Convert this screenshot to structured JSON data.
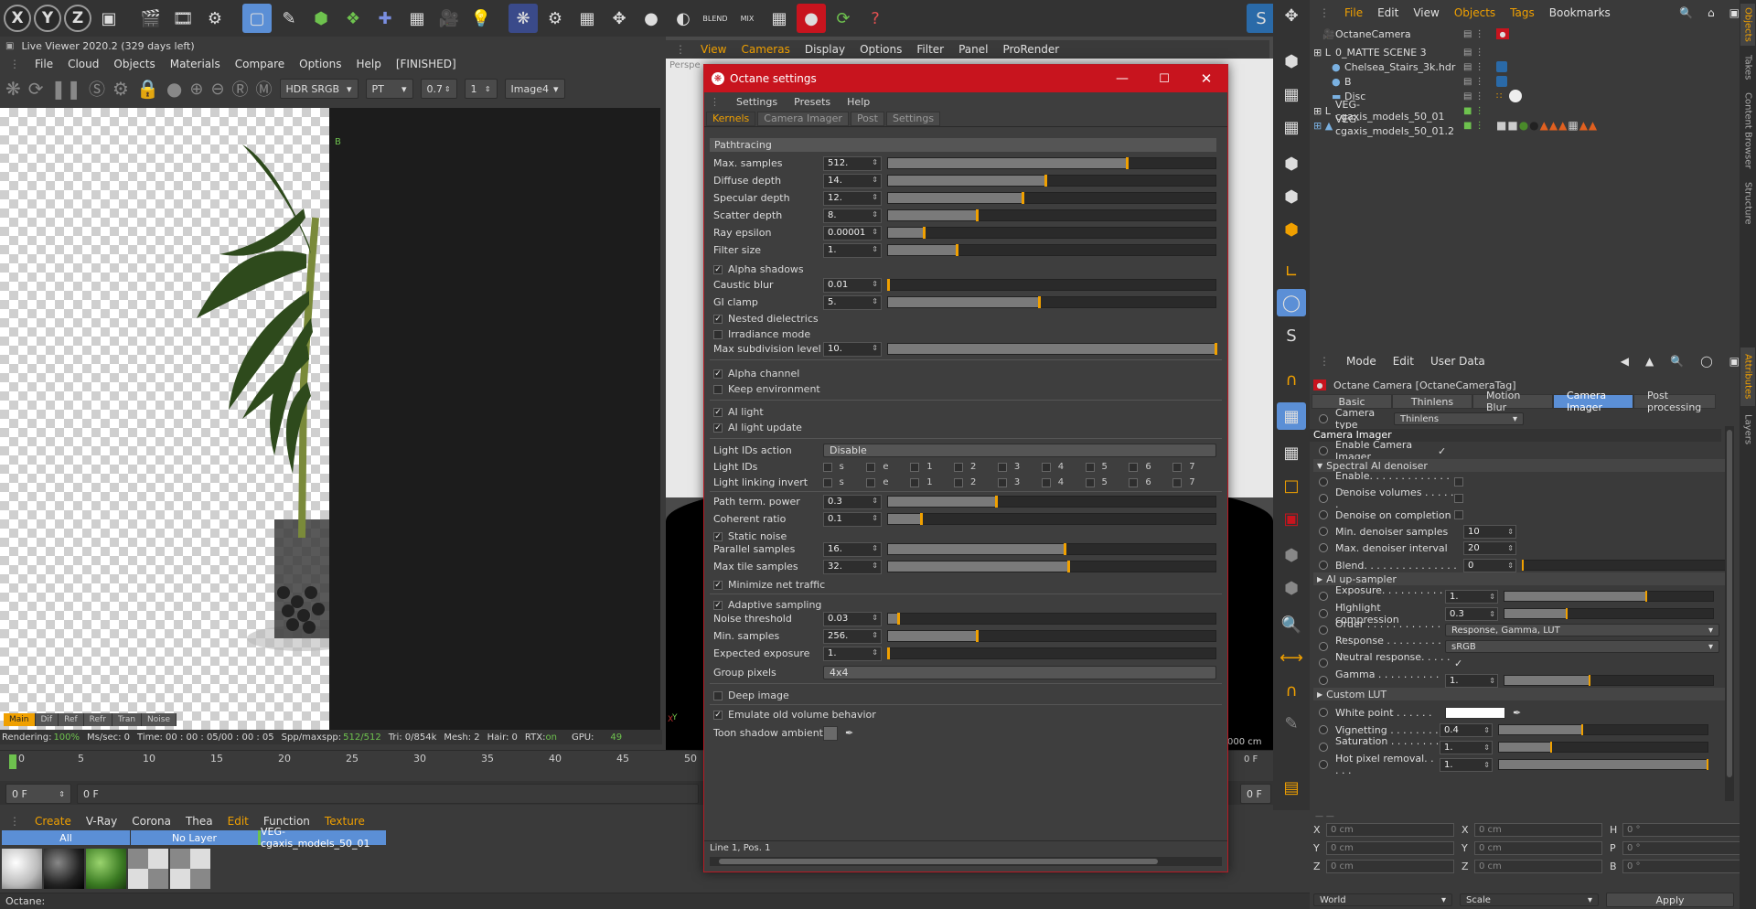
{
  "colors": {
    "accent": "#f0a000",
    "octane_red": "#c8141e",
    "selected_blue": "#5b8fd6",
    "badge_green": "#6ec24e"
  },
  "top_toolbar": {
    "x_label": "X",
    "y_label": "Y",
    "z_label": "Z",
    "blend_label": "BLEND",
    "mix_label": "MIX"
  },
  "live_viewer": {
    "title": "Live Viewer 2020.2 (329 days left)",
    "menu": [
      "File",
      "Cloud",
      "Objects",
      "Materials",
      "Compare",
      "Options",
      "Helр",
      "[FINISHED]"
    ],
    "hdr": "HDR SRGB",
    "kernel": "PT",
    "value1": "0.7",
    "value2": "1",
    "image": "Image4",
    "marker": "B",
    "pass_tabs": [
      "Main",
      "Dif",
      "Ref",
      "Refr",
      "Tran",
      "Noise"
    ],
    "status": {
      "rendering": "Rendering:",
      "pct": "100%",
      "ms": "Ms/sec: 0",
      "time": "Time: 00 : 00 : 05/00 : 00 : 05",
      "spp": "Spp/maxspp:",
      "spp_val": "512/512",
      "tri": "Tri: 0/854k",
      "mesh": "Mesh: 2",
      "hair": "Hair: 0",
      "rtx": "RTX:",
      "rtx_val": "on",
      "gpu": "GPU:",
      "gpu_val": "49"
    }
  },
  "timeline": {
    "ticks": [
      "0",
      "5",
      "10",
      "15",
      "20",
      "25",
      "30",
      "35",
      "40",
      "45",
      "50"
    ],
    "frame_left": "0 F",
    "frame_field": "0 F",
    "frame_field2": "0 F",
    "frame_right": "0 F",
    "units": "000 cm"
  },
  "materials": {
    "menu": [
      "Create",
      "V-Ray",
      "Corona",
      "Thea",
      "Edit",
      "Function",
      "Texture"
    ],
    "filters": [
      "All",
      "No Layer",
      "VEG-cgaxis_models_50_01"
    ]
  },
  "status_bar": "Octane:",
  "viewport": {
    "menu": [
      "View",
      "Cameras",
      "Display",
      "Options",
      "Filter",
      "Panel",
      "ProRender"
    ],
    "label": "Perspe",
    "axis_y": "Y",
    "axis_x": "X"
  },
  "octane": {
    "title": "Octane settings",
    "menu": [
      "Settings",
      "Presets",
      "Help"
    ],
    "tabs": [
      "Kernels",
      "Camera Imager",
      "Post",
      "Settings"
    ],
    "section": "Pathtracing",
    "rows": [
      {
        "label": "Max. samples",
        "value": "512.",
        "fill": 0.73
      },
      {
        "label": "Diffuse depth",
        "value": "14.",
        "fill": 0.48
      },
      {
        "label": "Specular depth",
        "value": "12.",
        "fill": 0.41
      },
      {
        "label": "Scatter depth",
        "value": "8.",
        "fill": 0.27
      },
      {
        "label": "Ray epsilon",
        "value": "0.00001",
        "fill": 0.11
      },
      {
        "label": "Filter size",
        "value": "1.",
        "fill": 0.21
      }
    ],
    "alpha_shadows": "Alpha shadows",
    "rows2": [
      {
        "label": "Caustic blur",
        "value": "0.01",
        "fill": 0.0
      },
      {
        "label": "GI clamp",
        "value": "5.",
        "fill": 0.46
      }
    ],
    "nested": "Nested dielectrics",
    "irradiance": "Irradiance mode",
    "max_subdiv": {
      "label": "Max subdivision level",
      "value": "10.",
      "fill": 1.0
    },
    "alpha_channel": "Alpha channel",
    "keep_env": "Keep environment",
    "ai_light": "AI light",
    "ai_light_update": "AI light update",
    "light_ids_action": {
      "label": "Light IDs action",
      "value": "Disable"
    },
    "light_ids": {
      "label": "Light IDs",
      "items": [
        "s",
        "e",
        "1",
        "2",
        "3",
        "4",
        "5",
        "6",
        "7"
      ]
    },
    "light_link": {
      "label": "Light linking invert",
      "items": [
        "s",
        "e",
        "1",
        "2",
        "3",
        "4",
        "5",
        "6",
        "7"
      ]
    },
    "rows3": [
      {
        "label": "Path term. power",
        "value": "0.3",
        "fill": 0.33
      },
      {
        "label": "Coherent ratio",
        "value": "0.1",
        "fill": 0.1
      }
    ],
    "static_noise": "Static noise",
    "rows4": [
      {
        "label": "Parallel samples",
        "value": "16.",
        "fill": 0.54
      },
      {
        "label": "Max tile samples",
        "value": "32.",
        "fill": 0.55
      }
    ],
    "min_net": "Minimize net traffic",
    "adaptive": "Adaptive sampling",
    "rows5": [
      {
        "label": "Noise threshold",
        "value": "0.03",
        "fill": 0.03
      },
      {
        "label": "Min. samples",
        "value": "256.",
        "fill": 0.27
      },
      {
        "label": "Expected exposure",
        "value": "1.",
        "fill": 0.0
      }
    ],
    "group_pixels": {
      "label": "Group pixels",
      "value": "4x4"
    },
    "deep_image": "Deep image",
    "emulate": "Emulate old volume behavior",
    "toon": "Toon shadow ambient",
    "status": "Line 1, Pos. 1"
  },
  "object_manager": {
    "menu": [
      "File",
      "Edit",
      "View",
      "Objects",
      "Tags",
      "Bookmarks"
    ],
    "objects": [
      "OctaneCamera",
      "0_MATTE SCENE 3",
      "Chelsea_Stairs_3k.hdr",
      "B",
      "Disc",
      "VEG-cgaxis_models_50_01",
      "VEG-cgaxis_models_50_01.2"
    ]
  },
  "attr": {
    "menu": [
      "Mode",
      "Edit",
      "User Data"
    ],
    "title": "Octane Camera [OctaneCameraTag]",
    "tabs": [
      "Basic",
      "Thinlens",
      "Motion Blur",
      "Camera Imager",
      "Post processing"
    ],
    "camera_type_label": "Camera type",
    "camera_type": "Thinlens",
    "section": "Camera Imager",
    "enable_imager": "Enable Camera Imager",
    "denoiser": "Spectral AI denoiser",
    "enable": "Enable. . . . . . . . . . . . . . .",
    "denoise_vol": "Denoise volumes . . . . . .",
    "denoise_comp": "Denoise on completion",
    "min_denoise": {
      "label": "Min. denoiser samples",
      "value": "10"
    },
    "max_denoise": {
      "label": "Max. denoiser interval",
      "value": "20"
    },
    "blend": {
      "label": "Blend. . . . . . . . . . . . . . .",
      "value": "0",
      "fill": 0.0
    },
    "upsampler": "AI up-sampler",
    "exposure": {
      "label": "Exposure. . . . . . . . . . . .",
      "value": "1.",
      "fill": 0.68
    },
    "highlight": {
      "label": "Highlight compression",
      "value": "0.3",
      "fill": 0.3
    },
    "order": {
      "label": "Order . . . . . . . . . . . . . . .",
      "value": "Response, Gamma, LUT"
    },
    "response": {
      "label": "Response . . . . . . . . . . .",
      "value": "sRGB"
    },
    "neutral": "Neutral response. . . . . .",
    "gamma": {
      "label": "Gamma . . . . . . . . . . . . .",
      "value": "1.",
      "fill": 0.41
    },
    "custom_lut": "Custom LUT",
    "white_point": "White point . . . . . .",
    "vignetting": {
      "label": "Vignetting . . . . . . . .",
      "value": "0.4",
      "fill": 0.4
    },
    "saturation": {
      "label": "Saturation . . . . . . . . .",
      "value": "1.",
      "fill": 0.25
    },
    "hot_pixel": {
      "label": "Hot pixel removal. . . . .",
      "value": "1.",
      "fill": 1.0
    }
  },
  "coords": {
    "x": "X",
    "y": "Y",
    "z": "Z",
    "h": "H",
    "p": "P",
    "b": "B",
    "zero_cm": "0 cm",
    "zero_deg": "0 °",
    "world": "World",
    "scale": "Scale",
    "apply": "Apply"
  },
  "side_tabs": [
    "Objects",
    "Takes",
    "Content Browser",
    "Structure",
    "Attributes",
    "Layers"
  ]
}
